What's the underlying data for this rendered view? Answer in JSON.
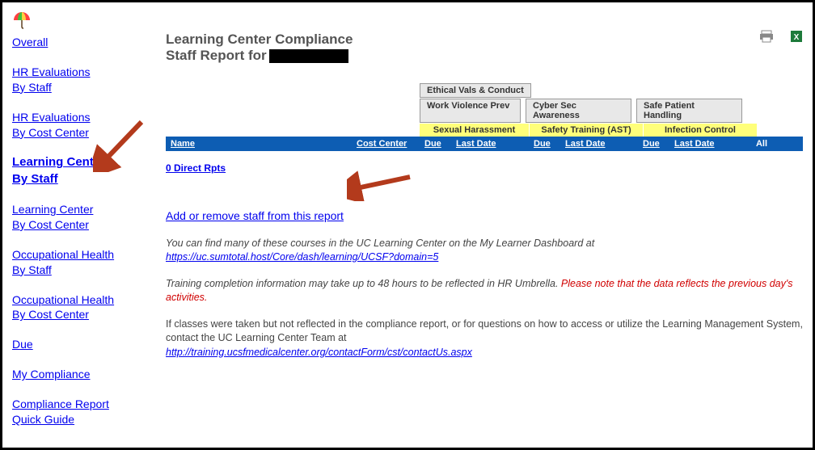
{
  "sidebar": {
    "items": [
      [
        "Overall"
      ],
      [
        "HR Evaluations",
        "By Staff"
      ],
      [
        "HR Evaluations",
        "By Cost Center"
      ],
      [
        "Learning Center",
        "By Staff"
      ],
      [
        "Learning Center",
        "By Cost Center"
      ],
      [
        "Occupational Health",
        "By Staff"
      ],
      [
        "Occupational Health",
        "By Cost Center"
      ],
      [
        "Due"
      ],
      [
        "My Compliance"
      ],
      [
        "Compliance Report",
        "Quick Guide"
      ]
    ],
    "active_index": 3
  },
  "header": {
    "title_line1": "Learning Center Compliance",
    "title_line2": "Staff Report for"
  },
  "tabs_row1": [
    "Ethical Vals & Conduct"
  ],
  "tabs_row2": [
    "Work Violence Prev",
    "Cyber Sec Awareness",
    "Safe Patient Handling"
  ],
  "categories": [
    "Sexual Harassment",
    "Safety Training (AST)",
    "Infection Control"
  ],
  "columns": {
    "name": "Name",
    "cost_center": "Cost Center",
    "due": "Due",
    "last_date": "Last Date",
    "all": "All"
  },
  "direct_reports": "0 Direct Rpts",
  "add_remove": "Add or remove staff from this report",
  "info_block1": {
    "pre": "You can find many of these courses in the UC Learning Center on the My Learner Dashboard at ",
    "url": "https://uc.sumtotal.host/Core/dash/learning/UCSF?domain=5"
  },
  "info_block2": {
    "plain": "Training completion information may take up to 48 hours to be reflected in HR Umbrella. ",
    "red": "Please note that the data reflects the previous day's activities."
  },
  "info_block3": {
    "text": "If classes were taken but not reflected in the compliance report, or for questions on how to access or utilize the Learning Management System, contact the UC Learning Center Team at",
    "url": "http://training.ucsfmedicalcenter.org/contactForm/cst/contactUs.aspx"
  }
}
